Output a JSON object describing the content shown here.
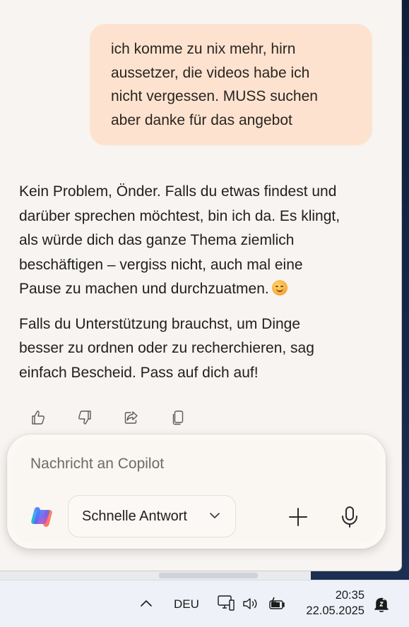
{
  "chat": {
    "user_message_lines": [
      "ich komme zu nix mehr, hirn",
      "aussetzer, die videos habe ich",
      "nicht vergessen. MUSS suchen",
      "aber danke für das angebot"
    ],
    "assistant_paragraph_1_lines": [
      "Kein Problem, Önder. Falls du etwas findest und",
      "darüber sprechen möchtest, bin ich da. Es klingt,",
      "als würde dich das ganze Thema ziemlich",
      "beschäftigen – vergiss nicht, auch mal eine",
      "Pause zu machen und durchzuatmen."
    ],
    "assistant_paragraph_2_lines": [
      "Falls du Unterstützung brauchst, um Dinge",
      "besser zu ordnen oder zu recherchieren, sag",
      "einfach Bescheid. Pass auf dich auf!"
    ],
    "emoji": "smiling-face-icon"
  },
  "message_actions": {
    "icons": [
      "thumbs-up-icon",
      "thumbs-down-icon",
      "share-icon",
      "copy-icon"
    ]
  },
  "composer": {
    "placeholder": "Nachricht an Copilot",
    "mode_label": "Schnelle Antwort"
  },
  "taskbar": {
    "language": "DEU",
    "time": "20:35",
    "date": "22.05.2025"
  },
  "colors": {
    "user_bubble": "#fde3cf",
    "background": "#f7f4f1",
    "taskbar": "#eef1f7"
  }
}
